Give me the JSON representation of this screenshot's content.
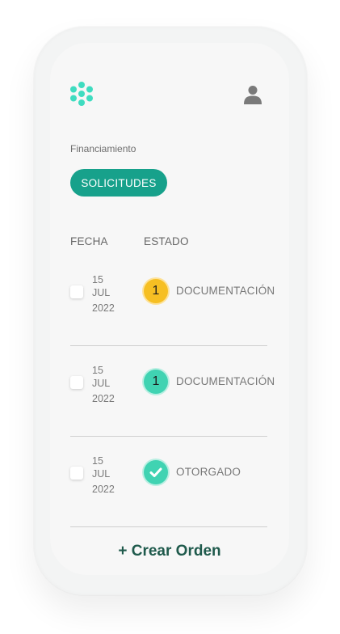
{
  "header": {
    "logo_icon": "flower-logo-icon",
    "user_icon": "user-icon"
  },
  "breadcrumb": "Financiamiento",
  "tab": {
    "label": "SOLICITUDES"
  },
  "table": {
    "headers": {
      "fecha": "FECHA",
      "estado": "ESTADO"
    },
    "rows": [
      {
        "day": "15",
        "month": "JUL",
        "year": "2022",
        "badge": "1",
        "badge_color": "#f6bf23",
        "status": "DOCUMENTACIÓN"
      },
      {
        "day": "15",
        "month": "JUL",
        "year": "2022",
        "badge": "1",
        "badge_color": "#40d3b2",
        "status": "DOCUMENTACIÓN"
      },
      {
        "day": "15",
        "month": "JUL",
        "year": "2022",
        "badge": "check-icon",
        "badge_color": "#40d3b2",
        "status": "OTORGADO"
      }
    ]
  },
  "create_button": "+ Crear Orden",
  "colors": {
    "accent": "#17a18b",
    "create_text": "#1f5a4c"
  }
}
